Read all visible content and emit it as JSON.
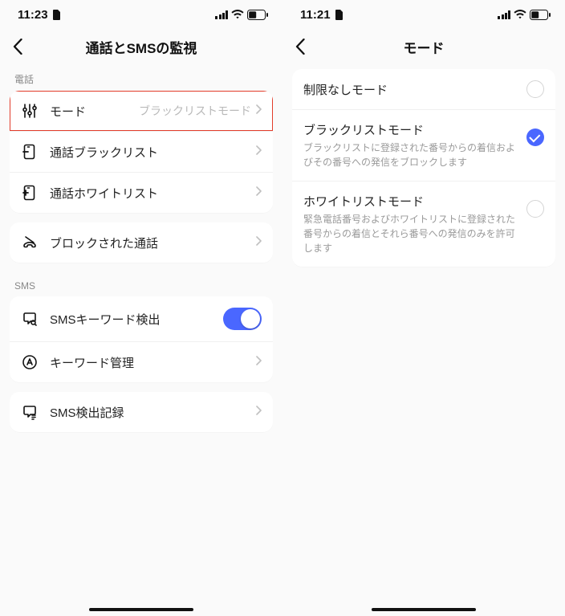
{
  "left": {
    "status_time": "11:23",
    "nav_title": "通話とSMSの監視",
    "section_phone": "電話",
    "section_sms": "SMS",
    "rows": {
      "mode": {
        "label": "モード",
        "value": "ブラックリストモード"
      },
      "blacklist": {
        "label": "通話ブラックリスト"
      },
      "whitelist": {
        "label": "通話ホワイトリスト"
      },
      "blocked": {
        "label": "ブロックされた通話"
      },
      "kw_detect": {
        "label": "SMSキーワード検出"
      },
      "kw_manage": {
        "label": "キーワード管理"
      },
      "sms_log": {
        "label": "SMS検出記録"
      }
    }
  },
  "right": {
    "status_time": "11:21",
    "nav_title": "モード",
    "options": {
      "none": {
        "title": "制限なしモード"
      },
      "black": {
        "title": "ブラックリストモード",
        "desc": "ブラックリストに登録された番号からの着信およびその番号への発信をブロックします"
      },
      "white": {
        "title": "ホワイトリストモード",
        "desc": "緊急電話番号およびホワイトリストに登録された番号からの着信とそれら番号への発信のみを許可します"
      }
    }
  }
}
